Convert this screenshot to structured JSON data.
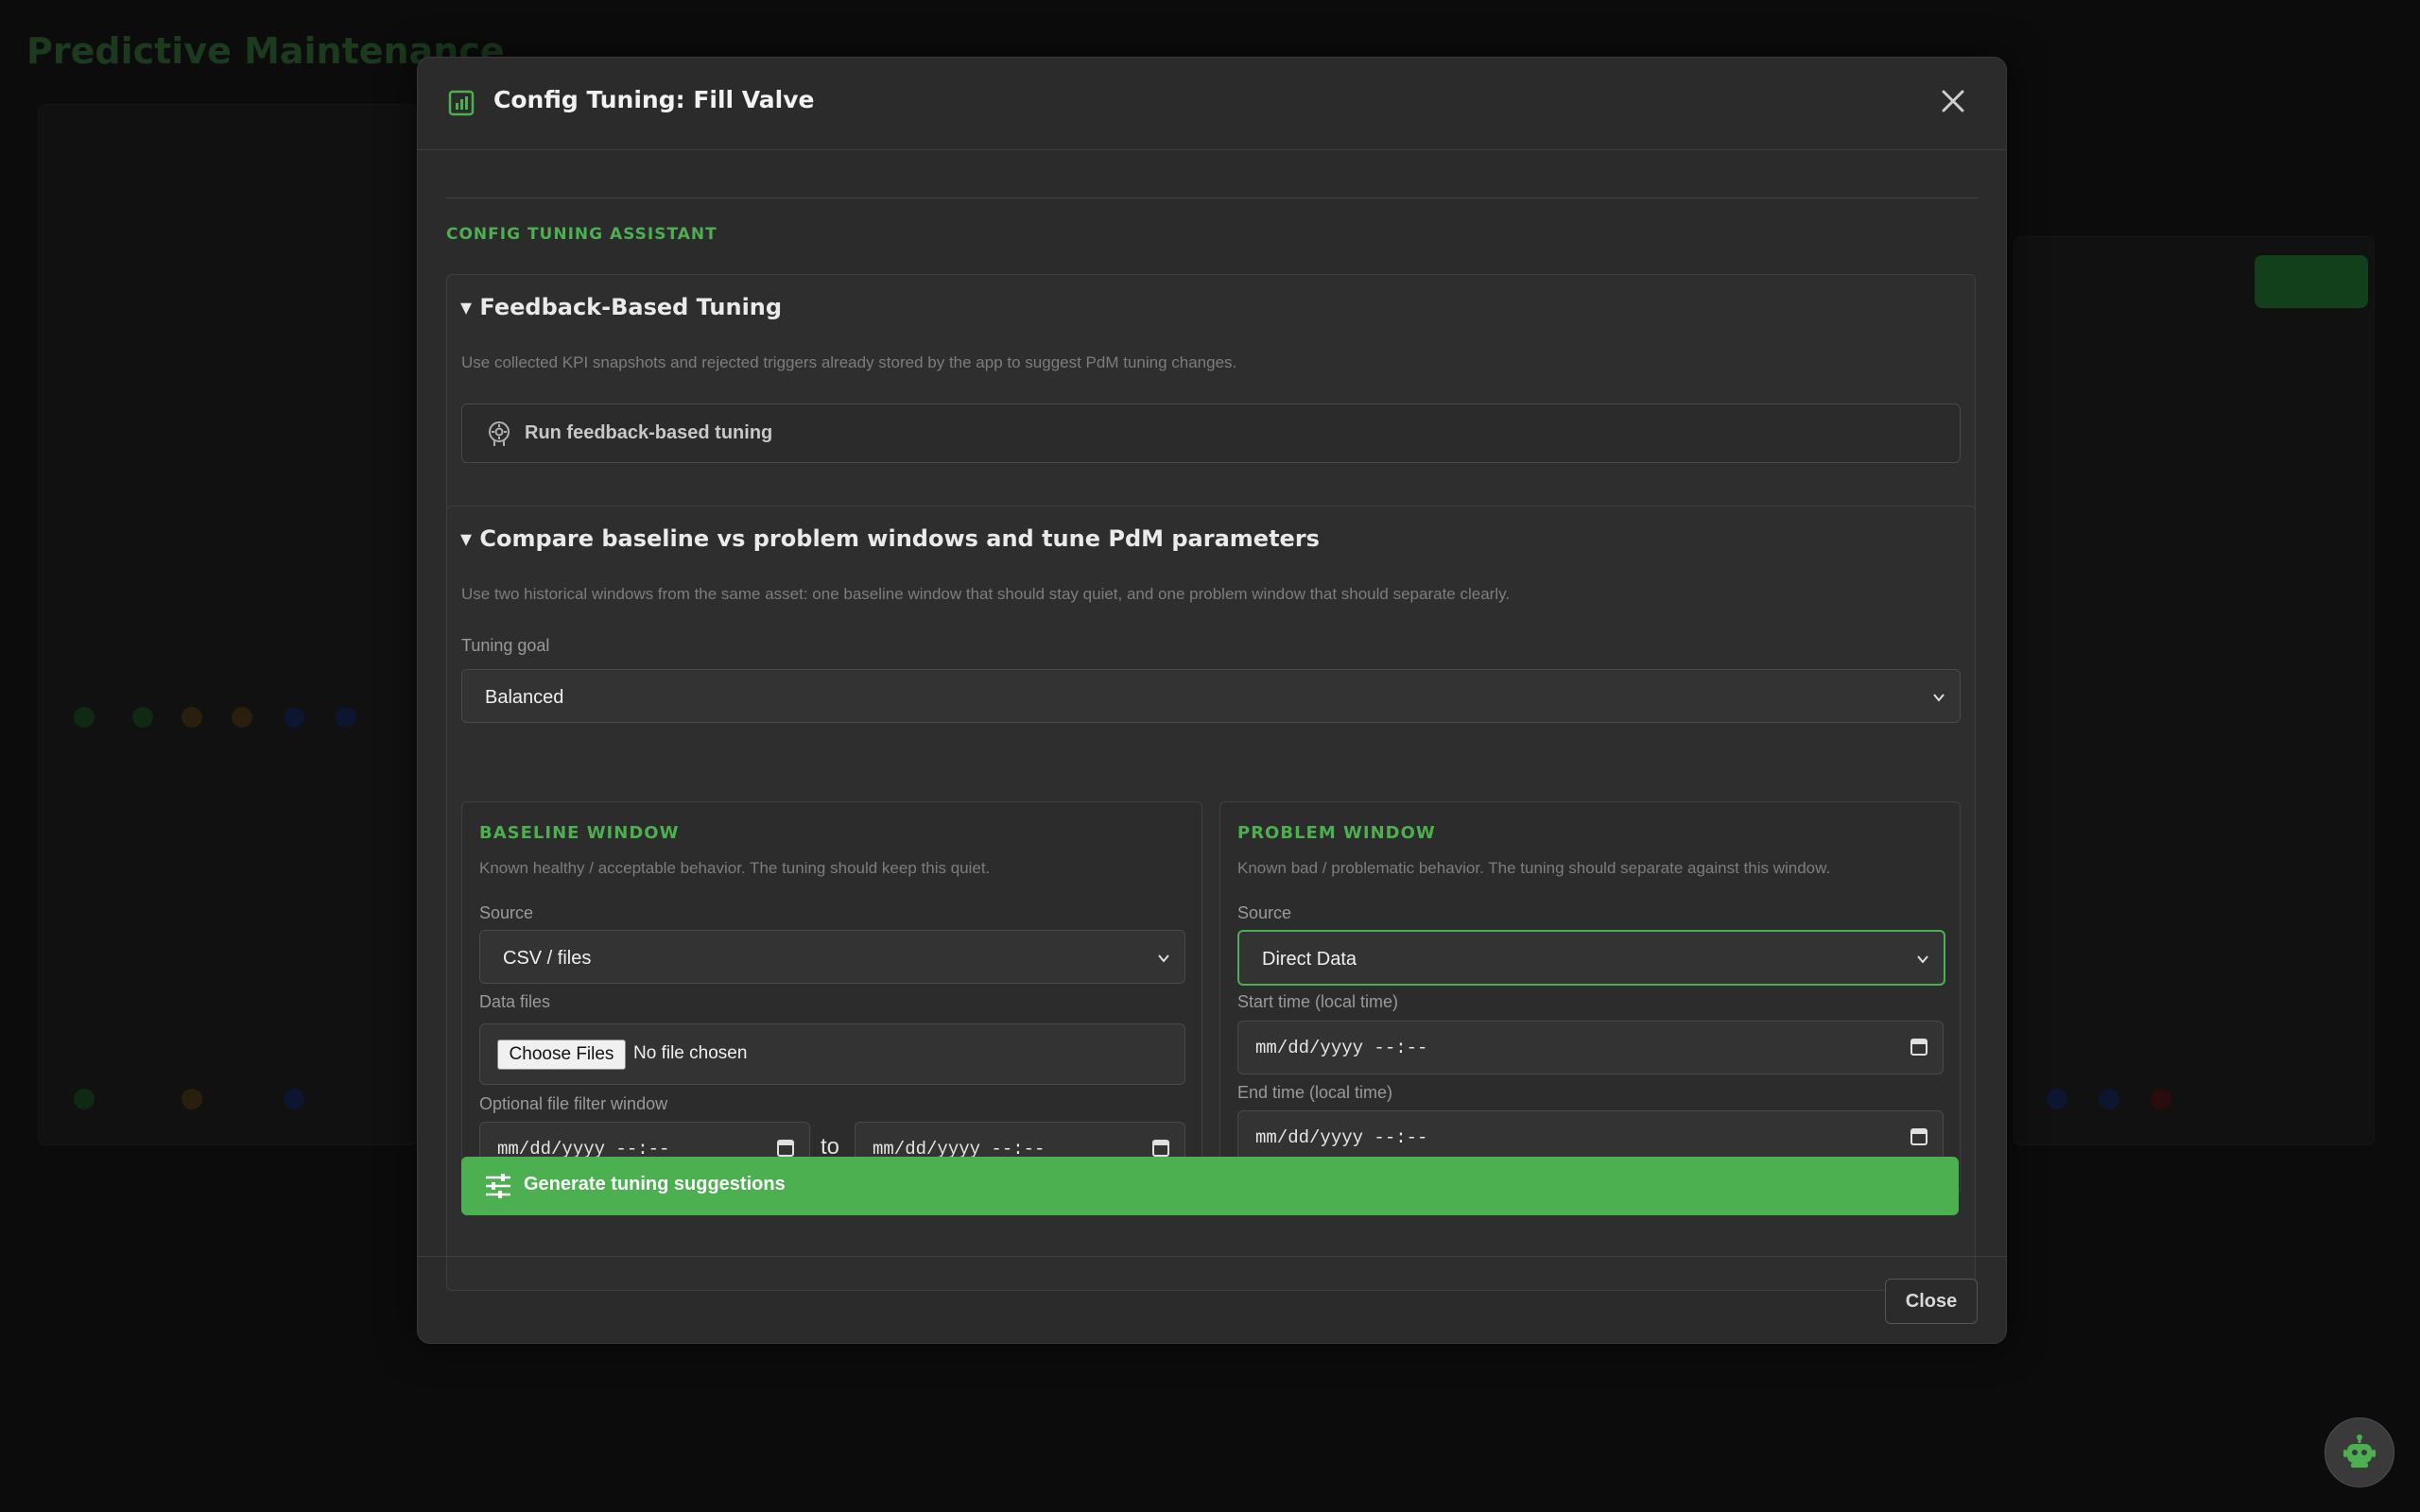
{
  "background": {
    "app_title": "Predictive Maintenance"
  },
  "modal": {
    "title": "Config Tuning: Fill Valve",
    "section_label": "CONFIG TUNING ASSISTANT",
    "feedback": {
      "summary": "Feedback-Based Tuning",
      "description": "Use collected KPI snapshots and rejected triggers already stored by the app to suggest PdM tuning changes.",
      "button_label": "Run feedback-based tuning"
    },
    "compare": {
      "summary": "Compare baseline vs problem windows and tune PdM parameters",
      "description": "Use two historical windows from the same asset: one baseline window that should stay quiet, and one problem window that should separate clearly.",
      "goal_label": "Tuning goal",
      "goal_value": "Balanced",
      "baseline": {
        "title": "BASELINE WINDOW",
        "description": "Known healthy / acceptable behavior. The tuning should keep this quiet.",
        "source_label": "Source",
        "source_value": "CSV / files",
        "files_label": "Data files",
        "choose_files": "Choose Files",
        "no_file": "No file chosen",
        "filter_label": "Optional file filter window",
        "filter_start": "mm/dd/yyyy --:--",
        "to": "to",
        "filter_end": "mm/dd/yyyy --:--"
      },
      "problem": {
        "title": "PROBLEM WINDOW",
        "description": "Known bad / problematic behavior. The tuning should separate against this window.",
        "source_label": "Source",
        "source_value": "Direct Data",
        "start_label": "Start time (local time)",
        "start_value": "mm/dd/yyyy --:--",
        "end_label": "End time (local time)",
        "end_value": "mm/dd/yyyy --:--"
      },
      "generate_label": "Generate tuning suggestions"
    },
    "close_label": "Close"
  },
  "colors": {
    "accent": "#4caf50",
    "modal_bg": "#2b2b2b",
    "page_bg": "#000000"
  },
  "icons": {
    "header": "chart-icon",
    "close": "close-icon",
    "feedback_button": "brain-gear-icon",
    "generate_button": "sliders-icon",
    "chevron": "chevron-down-icon",
    "calendar": "calendar-icon",
    "assistant": "robot-icon"
  }
}
